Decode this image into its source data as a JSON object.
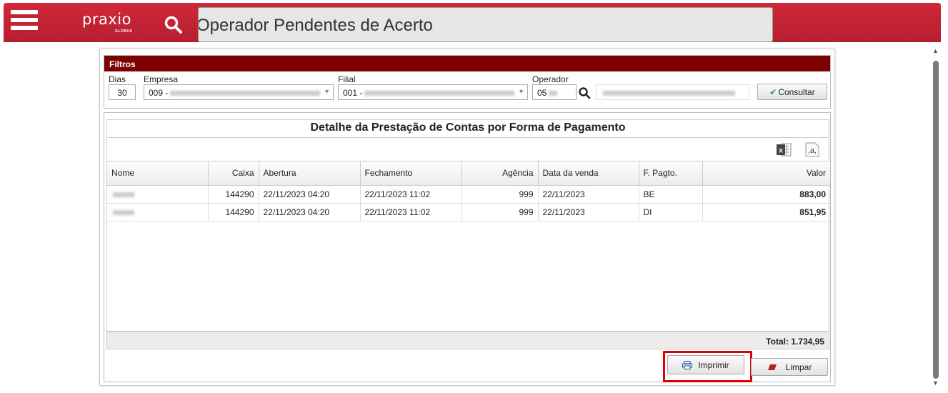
{
  "header": {
    "logo_text": "praxio",
    "logo_sub": "GLOBUS",
    "title": "Operador Pendentes de Acerto"
  },
  "filters": {
    "heading": "Filtros",
    "dias": {
      "label": "Dias",
      "value": "30"
    },
    "empresa": {
      "label": "Empresa",
      "value": "009 -"
    },
    "filial": {
      "label": "Filial",
      "value": "001 -"
    },
    "operador": {
      "label": "Operador",
      "value": "05"
    },
    "consultar_label": "Consultar"
  },
  "grid": {
    "title": "Detalhe da Prestação de Contas por Forma de Pagamento",
    "columns": [
      "Nome",
      "Caixa",
      "Abertura",
      "Fechamento",
      "Agência",
      "Data da venda",
      "F. Pagto.",
      "Valor"
    ],
    "rows": [
      {
        "nome": "",
        "caixa": "144290",
        "abertura": "22/11/2023 04:20",
        "fechamento": "22/11/2023 11:02",
        "agencia": "999",
        "data_venda": "22/11/2023",
        "f_pagto": "BE",
        "valor": "883,00"
      },
      {
        "nome": "",
        "caixa": "144290",
        "abertura": "22/11/2023 04:20",
        "fechamento": "22/11/2023 11:02",
        "agencia": "999",
        "data_venda": "22/11/2023",
        "f_pagto": "DI",
        "valor": "851,95"
      }
    ],
    "total": "Total: 1.734,95"
  },
  "actions": {
    "imprimir_label": "Imprimir",
    "limpar_label": "Limpar"
  },
  "colors": {
    "header_red": "#c52334",
    "filters_head": "#7d0000",
    "highlight": "#e00000"
  }
}
